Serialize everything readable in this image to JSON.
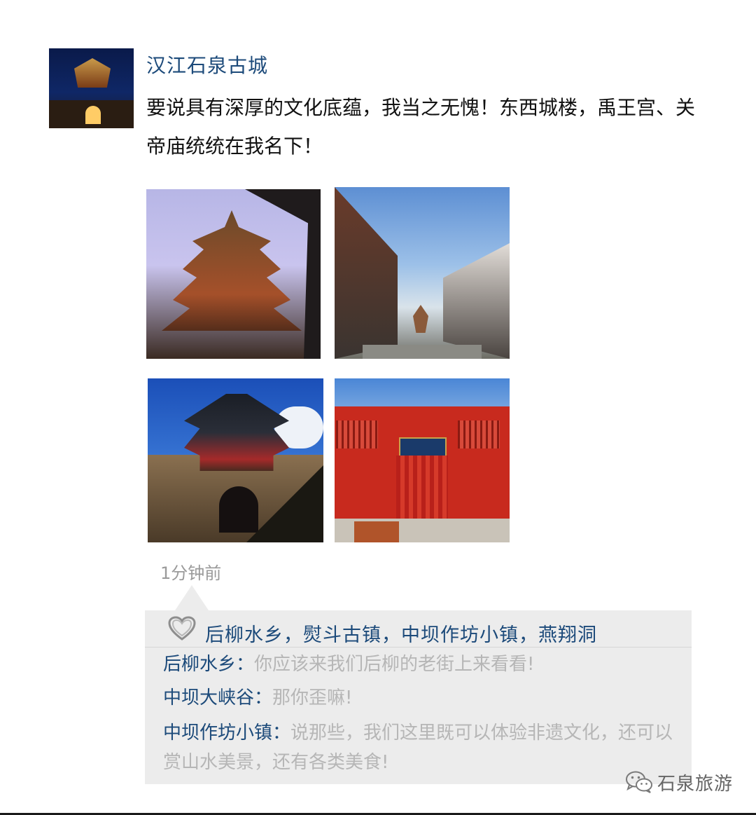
{
  "post": {
    "username": "汉江石泉古城",
    "text": "要说具有深厚的文化底蕴，我当之无愧！东西城楼，禹王宫、关帝庙统统在我名下！",
    "time": "1分钟前"
  },
  "photos": [
    {
      "icon": "pagoda-photo"
    },
    {
      "icon": "old-street-photo"
    },
    {
      "icon": "city-gate-photo"
    },
    {
      "icon": "temple-hall-photo"
    }
  ],
  "likes": {
    "icon": "heart-icon",
    "names": "后柳水乡，熨斗古镇，中坝作坊小镇，燕翔洞"
  },
  "comments": [
    {
      "author": "后柳水乡",
      "sep": "：",
      "text": "你应该来我们后柳的老街上来看看!"
    },
    {
      "author": "中坝大峡谷",
      "sep": "：",
      "text": "那你歪嘛!"
    },
    {
      "author": "中坝作坊小镇",
      "sep": "：",
      "text": "说那些，我们这里既可以体验非遗文化，还可以赏山水美景，还有各类美食!"
    }
  ],
  "watermark": {
    "icon": "wechat-icon",
    "text": "石泉旅游"
  },
  "colors": {
    "name_blue": "#1c4a7a",
    "comment_gray": "#b6b6b6",
    "box_bg": "#ececec"
  }
}
